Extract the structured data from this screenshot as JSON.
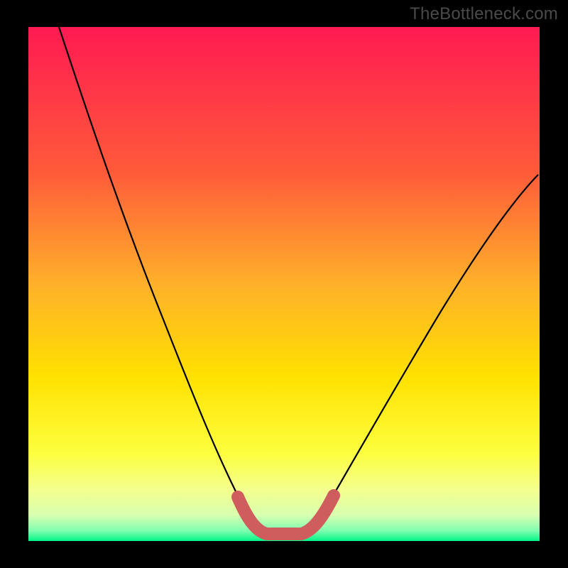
{
  "watermark": "TheBottleneck.com",
  "chart_data": {
    "type": "line",
    "title": "",
    "xlabel": "",
    "ylabel": "",
    "xlim": [
      0,
      100
    ],
    "ylim": [
      0,
      100
    ],
    "background_gradient": {
      "top": "#ff1a52",
      "mid1": "#ff8a2a",
      "mid2": "#ffe600",
      "bottom_band": "#f5ff8a",
      "bottom_edge": "#00ff87"
    },
    "series": [
      {
        "name": "bottleneck-curve",
        "type": "spline",
        "stroke": "#000000",
        "stroke_width": 2,
        "points": [
          {
            "x": 6,
            "y": 100
          },
          {
            "x": 14,
            "y": 82
          },
          {
            "x": 22,
            "y": 60
          },
          {
            "x": 30,
            "y": 38
          },
          {
            "x": 36,
            "y": 20
          },
          {
            "x": 41,
            "y": 8
          },
          {
            "x": 44,
            "y": 3
          },
          {
            "x": 47,
            "y": 1.5
          },
          {
            "x": 53,
            "y": 1.5
          },
          {
            "x": 56,
            "y": 3
          },
          {
            "x": 60,
            "y": 10
          },
          {
            "x": 68,
            "y": 26
          },
          {
            "x": 78,
            "y": 44
          },
          {
            "x": 88,
            "y": 58
          },
          {
            "x": 98,
            "y": 68
          }
        ]
      },
      {
        "name": "optimal-zone",
        "type": "spline",
        "stroke": "#d15a5a",
        "stroke_width": 12,
        "linecap": "round",
        "points": [
          {
            "x": 41,
            "y": 8
          },
          {
            "x": 44,
            "y": 3
          },
          {
            "x": 47,
            "y": 1.5
          },
          {
            "x": 53,
            "y": 1.5
          },
          {
            "x": 56,
            "y": 3
          },
          {
            "x": 59,
            "y": 8
          }
        ]
      }
    ],
    "frame": {
      "border_color": "#000000",
      "border_width_px": 40
    }
  }
}
